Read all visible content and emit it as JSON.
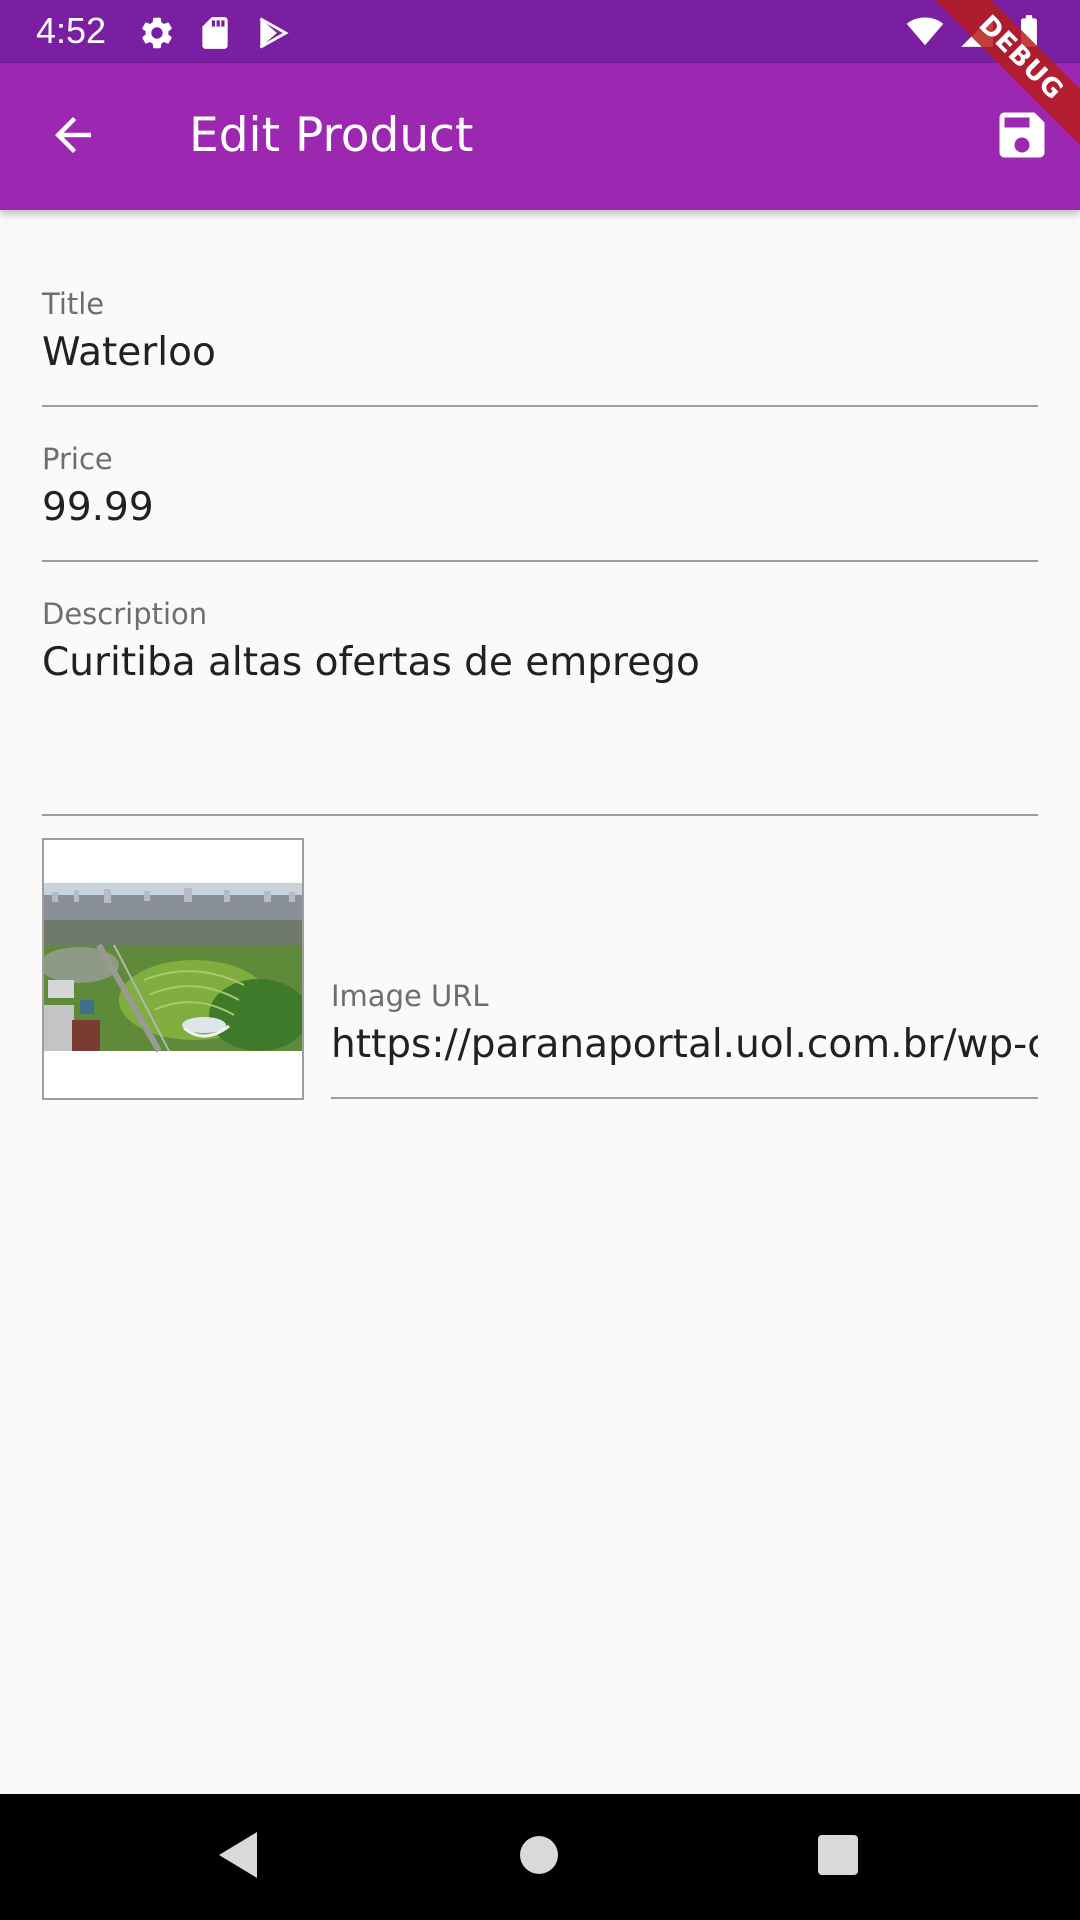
{
  "status_bar": {
    "time": "4:52",
    "left_icons": [
      "settings-icon",
      "sd-card-icon",
      "play-store-icon"
    ],
    "right_icons": [
      "wifi-icon",
      "cell-signal-icon",
      "battery-icon"
    ]
  },
  "app_bar": {
    "title": "Edit Product",
    "back_icon": "arrow-back-icon",
    "save_icon": "save-icon",
    "background": "#9c27b0",
    "status_background": "#7b1fa2"
  },
  "debug_banner": {
    "label": "DEBUG"
  },
  "form": {
    "title": {
      "label": "Title",
      "value": "Waterloo"
    },
    "price": {
      "label": "Price",
      "value": "99.99"
    },
    "description": {
      "label": "Description",
      "value": "Curitiba altas ofertas de emprego"
    },
    "image_url": {
      "label": "Image URL",
      "value": "https://paranaportal.uol.com.br/wp-content"
    }
  },
  "image_preview": {
    "icon": "city-aerial-photo"
  },
  "nav_bar": {
    "back_icon": "nav-back-icon",
    "home_icon": "nav-home-icon",
    "recents_icon": "nav-recents-icon"
  }
}
